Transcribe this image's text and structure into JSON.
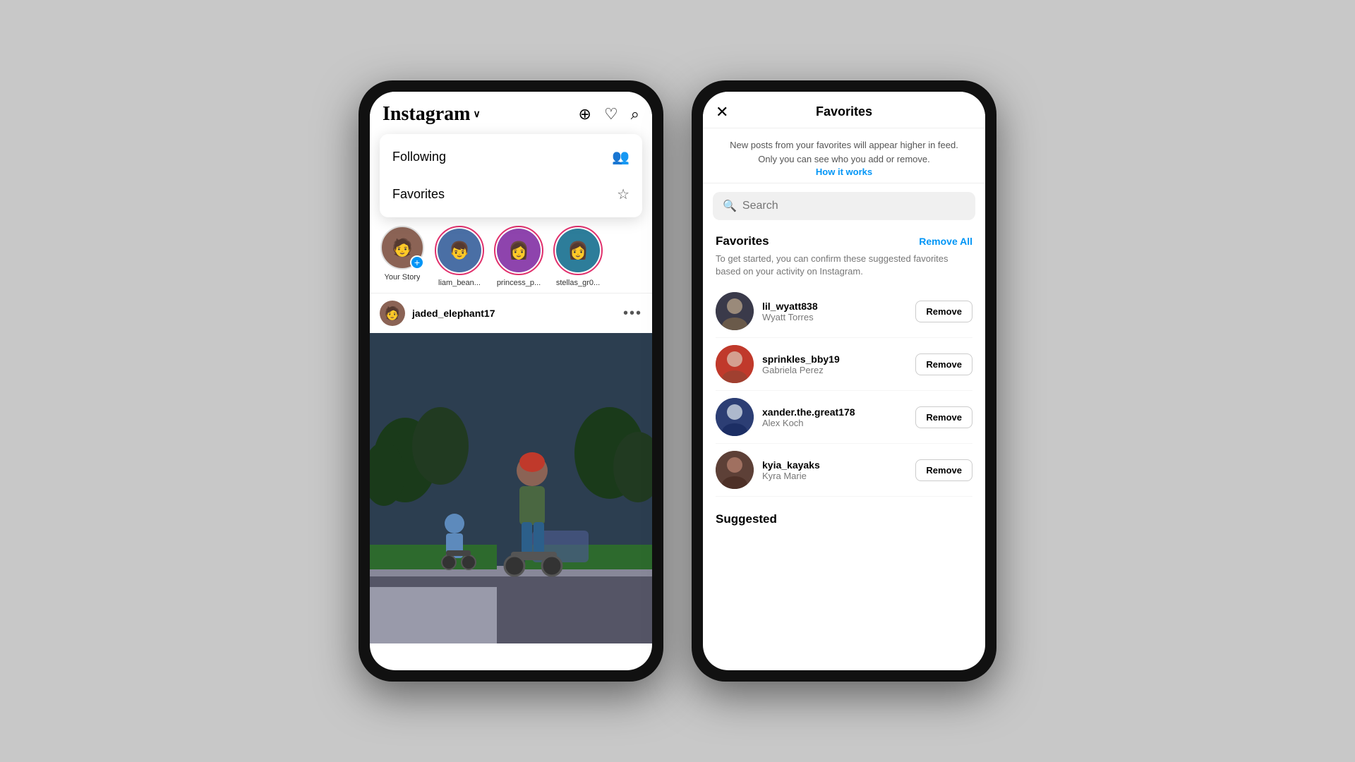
{
  "left_phone": {
    "header": {
      "logo": "Instagram",
      "chevron": "∨",
      "icons": [
        "⊕",
        "♡",
        "⌕"
      ]
    },
    "dropdown": {
      "items": [
        {
          "label": "Following",
          "icon": "👥"
        },
        {
          "label": "Favorites",
          "icon": "☆"
        }
      ]
    },
    "stories": [
      {
        "name": "Your Story",
        "add": true
      },
      {
        "name": "liam_bean...",
        "ring": true
      },
      {
        "name": "princess_p...",
        "ring": true
      },
      {
        "name": "stellas_gr0...",
        "ring": true
      }
    ],
    "post": {
      "username": "jaded_elephant17",
      "more": "•••"
    }
  },
  "right_phone": {
    "header": {
      "close": "✕",
      "title": "Favorites"
    },
    "info_text": "New posts from your favorites will appear higher in feed.\nOnly you can see who you add or remove.",
    "info_link": "How it works",
    "search_placeholder": "Search",
    "favorites_section": {
      "title": "Favorites",
      "remove_all": "Remove All",
      "subtitle": "To get started, you can confirm these suggested favorites based on your activity on Instagram.",
      "users": [
        {
          "username": "lil_wyatt838",
          "realname": "Wyatt Torres",
          "btn": "Remove"
        },
        {
          "username": "sprinkles_bby19",
          "realname": "Gabriela Perez",
          "btn": "Remove"
        },
        {
          "username": "xander.the.great178",
          "realname": "Alex Koch",
          "btn": "Remove"
        },
        {
          "username": "kyia_kayaks",
          "realname": "Kyra Marie",
          "btn": "Remove"
        }
      ]
    },
    "suggested_section": {
      "title": "Suggested"
    }
  }
}
